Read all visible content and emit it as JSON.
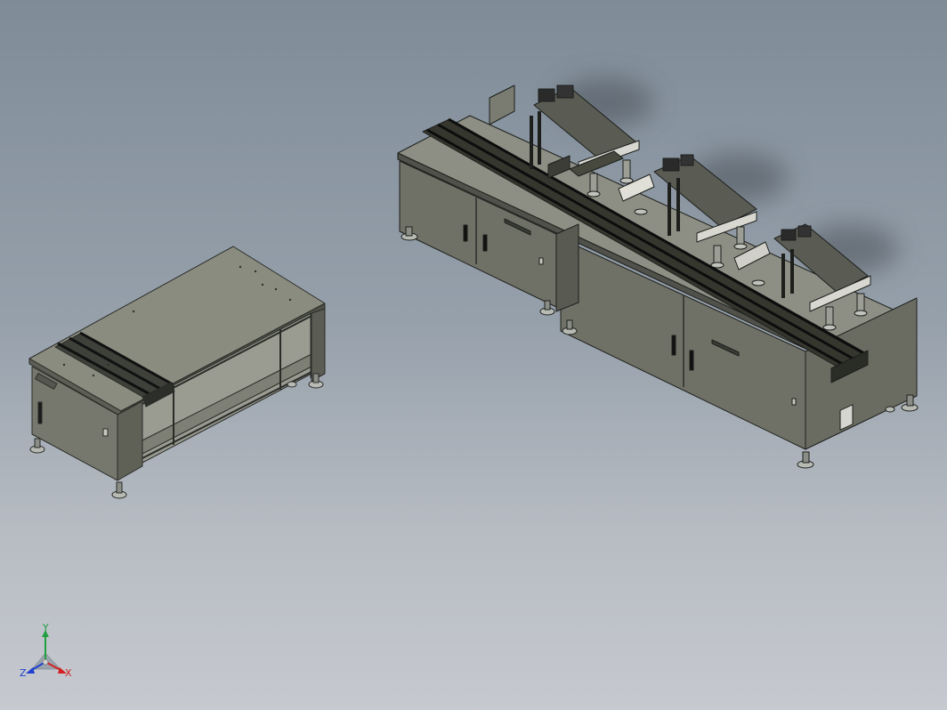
{
  "viewport": {
    "background_top": "#7f8c98",
    "background_bottom": "#c6c9cf"
  },
  "models": {
    "small_workbench": {
      "body_color": "#75776a",
      "top_color": "#8a8c7f",
      "edge_color": "#2a2c28"
    },
    "production_line": {
      "body_color": "#6f7166",
      "top_color": "#8d8f84",
      "edge_color": "#1d1f1c",
      "stations": 3
    }
  },
  "triad": {
    "x_label": "X",
    "y_label": "Y",
    "z_label": "Z",
    "x_color": "#d42020",
    "y_color": "#20a040",
    "z_color": "#2040d0"
  }
}
